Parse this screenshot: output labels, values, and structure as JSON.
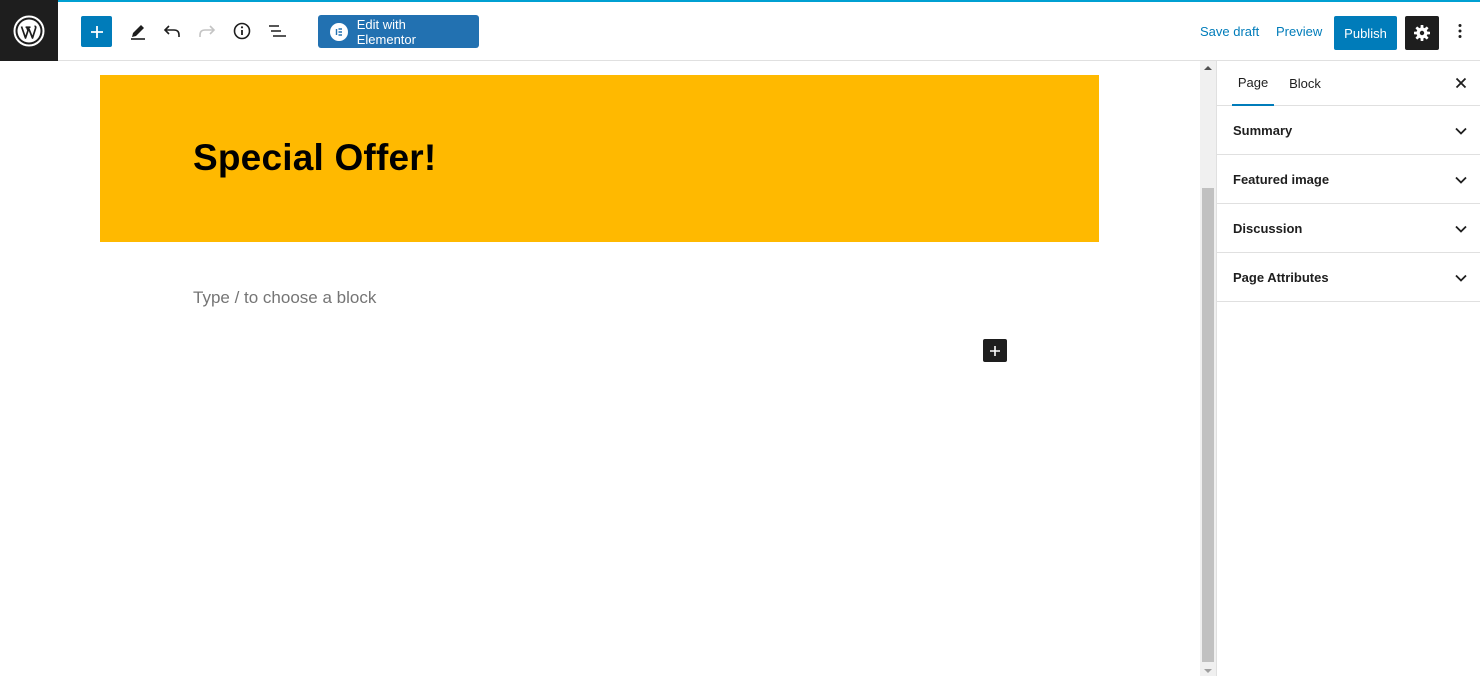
{
  "toolbar": {
    "edit_with_elementor": "Edit with Elementor",
    "save_draft": "Save draft",
    "preview": "Preview",
    "publish": "Publish"
  },
  "editor": {
    "banner_title": "Special Offer!",
    "placeholder": "Type / to choose a block",
    "banner_color": "#ffb900"
  },
  "sidebar": {
    "tabs": [
      {
        "label": "Page",
        "active": true
      },
      {
        "label": "Block",
        "active": false
      }
    ],
    "panels": [
      {
        "label": "Summary"
      },
      {
        "label": "Featured image"
      },
      {
        "label": "Discussion"
      },
      {
        "label": "Page Attributes"
      }
    ]
  },
  "colors": {
    "accent": "#007cba",
    "elementor": "#2271b1",
    "dark": "#1e1e1e"
  },
  "icons": [
    "wordpress-logo-icon",
    "plus-icon",
    "pencil-icon",
    "undo-icon",
    "redo-icon",
    "info-icon",
    "list-view-icon",
    "elementor-icon",
    "gear-icon",
    "more-vertical-icon",
    "close-icon",
    "chevron-down-icon"
  ]
}
